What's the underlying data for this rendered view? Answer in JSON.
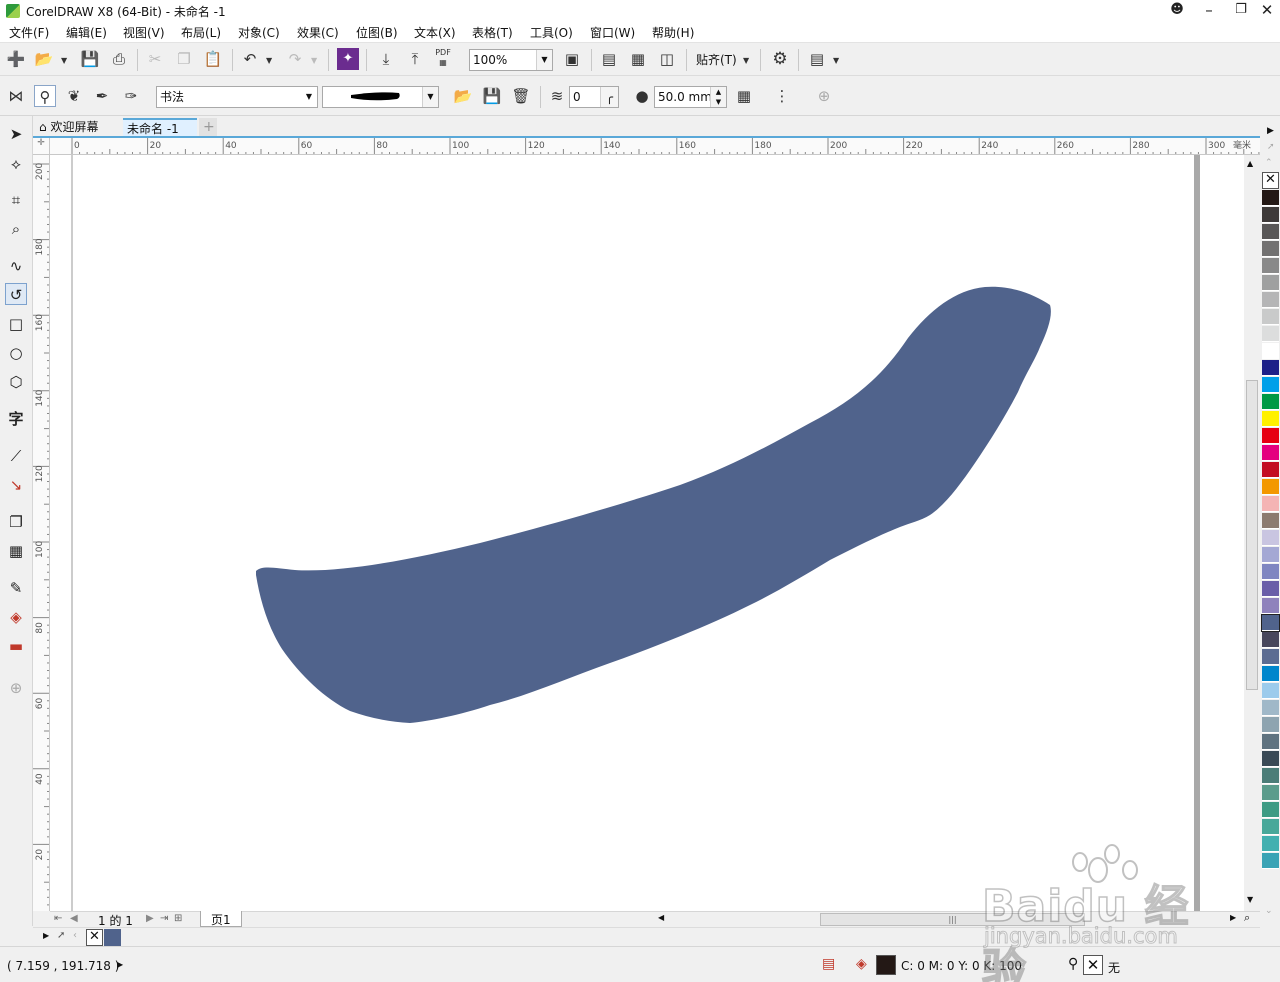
{
  "window": {
    "title": "CorelDRAW X8 (64-Bit) - 未命名 -1"
  },
  "menu": [
    "文件(F)",
    "编辑(E)",
    "视图(V)",
    "布局(L)",
    "对象(C)",
    "效果(C)",
    "位图(B)",
    "文本(X)",
    "表格(T)",
    "工具(O)",
    "窗口(W)",
    "帮助(H)"
  ],
  "toolbar": {
    "zoom_value": "100%",
    "snap_label": "贴齐(T)",
    "pdf_label": "PDF"
  },
  "property_bar": {
    "brush_style": "书法",
    "smoothing_value": "0",
    "width_value": "50.0 mm"
  },
  "tabs": {
    "welcome": "欢迎屏幕",
    "document": "未命名 -1"
  },
  "ruler": {
    "unit": "毫米",
    "h_ticks": [
      "0",
      "20",
      "40",
      "60",
      "80",
      "100",
      "120",
      "140",
      "160",
      "180",
      "200",
      "220",
      "240",
      "260",
      "280",
      "300"
    ],
    "v_ticks": [
      "200",
      "180",
      "160",
      "140",
      "120",
      "100",
      "80",
      "60",
      "40",
      "20"
    ]
  },
  "canvas": {
    "shape_fill": "#50638c"
  },
  "toolbox_glyphs": {
    "pick": "➤",
    "shape": "⟡",
    "crop": "⌗",
    "zoom": "⌕",
    "freehand": "∿",
    "artistic": "↺",
    "rect": "□",
    "ellipse": "○",
    "polygon": "⬡",
    "text": "字",
    "parallel": "⟋",
    "connector": "↘",
    "shadow": "❐",
    "transparency": "▦",
    "eyedropper": "✎",
    "fill": "◈",
    "outline": "▬",
    "add": "⊕"
  },
  "palette_colors": [
    "#231815",
    "#3e3a39",
    "#595757",
    "#727171",
    "#898989",
    "#9fa0a0",
    "#b5b5b6",
    "#c9caca",
    "#dcdddd",
    "#ffffff",
    "#1d2088",
    "#00a0e9",
    "#009944",
    "#fff100",
    "#e60012",
    "#e4007f",
    "#c30d23",
    "#f39800",
    "#f4b4b4",
    "#8c7b6f",
    "#c9c5e1",
    "#a4a8d4",
    "#7f86c1",
    "#6a5ea8",
    "#8f82bc",
    "#50638c",
    "#48475c",
    "#5c6c92",
    "#0086cc",
    "#9ccbec",
    "#a0b8c8",
    "#8ea4b0",
    "#5f7380",
    "#3a4a56",
    "#4b7d78",
    "#5b9c8c",
    "#3e9b84",
    "#48a89a",
    "#42b0b0",
    "#3aa3b5"
  ],
  "pagebar": {
    "page_counter": "1 的 1",
    "page_tab": "页1"
  },
  "status": {
    "coords": "( 7.159 , 191.718 )",
    "fill_info": "C: 0 M: 0 Y: 0 K: 100",
    "outline_info": "无"
  },
  "watermark": {
    "brand": "Baidu 经验",
    "url": "jingyan.baidu.com"
  }
}
